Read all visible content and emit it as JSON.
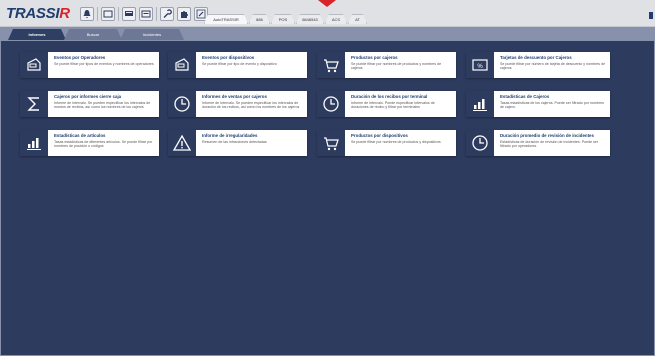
{
  "app": {
    "logo_main": "TRASSI",
    "logo_r": "R"
  },
  "toolbar": {
    "icons": [
      "bell-icon",
      "grid-icon",
      "messages-icon",
      "list-icon",
      "wrench-icon",
      "puzzle-icon",
      "edit-icon"
    ]
  },
  "right_tabs": [
    "AutoTRASSIR",
    "886",
    "POS",
    "6846543",
    "ACS",
    "AT"
  ],
  "tabs": [
    "Informes",
    "Buscar",
    "Incidentes"
  ],
  "reports": [
    {
      "title": "Eventos por Operadores",
      "desc": "Se puede filtrar por tipos de eventos y nombres de operadores",
      "icon": "register-icon"
    },
    {
      "title": "Eventos por dispositivos",
      "desc": "Se puede filtrar por tipo de evento y dispositivo",
      "icon": "register-icon"
    },
    {
      "title": "Productos por cajeros",
      "desc": "Se puede filtrar por nombres de productos y nombres de cajeros",
      "icon": "cart-icon"
    },
    {
      "title": "Tarjetas de descuento por Cajeros",
      "desc": "Se puede filtrar por número de tarjeta de descuento y nombres de cajeros",
      "icon": "percent-icon"
    },
    {
      "title": "Cajeros por informes cierre caja",
      "desc": "Informe de intervalo. Se pueden especificar los intervalos de montos de recibos, así como los nombres de los cajeros",
      "icon": "sigma-icon"
    },
    {
      "title": "Informes de ventas por cajeros",
      "desc": "Informe de intervalo. Se pueden especificar los intervalos de duración de los recibos, así como los nombres de los cajeros",
      "icon": "clock-icon"
    },
    {
      "title": "Duración de los recibos por terminal",
      "desc": "Informe de intervalo. Puede especificar intervalos de duraciones de recibo y filtrar por terminales",
      "icon": "clock-icon"
    },
    {
      "title": "Estadísticas de Cajeros",
      "desc": "Tasas estadísticas de los cajeros. Puede ser filtrado por nombres de cajero.",
      "icon": "bar-chart-icon"
    },
    {
      "title": "Estadísticas de artículos",
      "desc": "Tasas estadísticas de diferentes artículos. Se puede filtrar por nombres de posición o códigos",
      "icon": "bar-chart-icon"
    },
    {
      "title": "Informe de irregularidades",
      "desc": "Resumen de las infracciones detectadas",
      "icon": "warning-icon"
    },
    {
      "title": "Productos por dispositivos",
      "desc": "Se puede filtrar por nombres de productos y dispositivos",
      "icon": "cart-icon"
    },
    {
      "title": "Duración promedio de revisión de incidentes",
      "desc": "Estadísticas de duración de revisión de incidentes. Puede ser filtrado por operadores.",
      "icon": "clock-icon"
    }
  ]
}
